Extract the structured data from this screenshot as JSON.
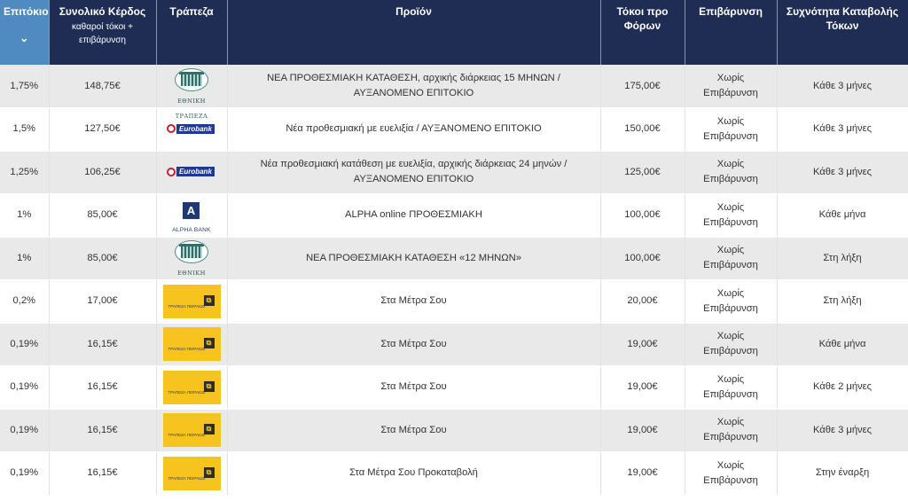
{
  "colors": {
    "header_bg": "#1f2d54",
    "header_sorted_bg": "#4f8bc0",
    "row_alt_bg": "#e9e9e9",
    "piraeus_yellow": "#f7c41f",
    "eurobank_blue": "#1c3a8f",
    "eurobank_red": "#c8202e",
    "alpha_blue": "#1f3a72",
    "nbg_teal": "#2e6f6a"
  },
  "header": {
    "rate": "Επιτόκιο",
    "sort_icon": "chevron-down-icon",
    "sort_glyph": "⌄",
    "gain": "Συνολικό Κέρδος",
    "gain_sub": "καθαροί τόκοι + επιβάρυνση",
    "bank": "Τράπεζα",
    "product": "Προϊόν",
    "interest": "Τόκοι προ Φόρων",
    "charge": "Επιβάρυνση",
    "frequency": "Συχνότητα Καταβολής Τόκων"
  },
  "logos": {
    "nbg": "ΕΘΝΙΚΗ ΤΡΑΠΕΖΑ",
    "eurobank": "Eurobank",
    "alpha": "ALPHA BANK",
    "alpha_glyph": "A",
    "piraeus": "ΤΡΑΠΕΖΑ ΠΕΙΡΑΙΩΣ",
    "piraeus_glyph": "⧉"
  },
  "rows": [
    {
      "rate": "1,75%",
      "gain": "148,75€",
      "bank": "nbg",
      "product": "ΝΕΑ ΠΡΟΘΕΣΜΙΑΚΗ ΚΑΤΑΘΕΣΗ, αρχικής διάρκειας 15 ΜΗΝΩΝ / ΑΥΞΑΝΟΜΕΝΟ ΕΠΙΤΟΚΙΟ",
      "interest": "175,00€",
      "charge": "Χωρίς Επιβάρυνση",
      "frequency": "Κάθε 3 μήνες"
    },
    {
      "rate": "1,5%",
      "gain": "127,50€",
      "bank": "eurobank",
      "product": "Νέα προθεσμιακή με ευελιξία / ΑΥΞΑΝΟΜΕΝΟ ΕΠΙΤΟΚΙΟ",
      "interest": "150,00€",
      "charge": "Χωρίς Επιβάρυνση",
      "frequency": "Κάθε 3 μήνες"
    },
    {
      "rate": "1,25%",
      "gain": "106,25€",
      "bank": "eurobank",
      "product": "Νέα προθεσμιακή κατάθεση με ευελιξία, αρχικής διάρκειας 24 μηνών / ΑΥΞΑΝΟΜΕΝΟ ΕΠΙΤΟΚΙΟ",
      "interest": "125,00€",
      "charge": "Χωρίς Επιβάρυνση",
      "frequency": "Κάθε 3 μήνες"
    },
    {
      "rate": "1%",
      "gain": "85,00€",
      "bank": "alpha",
      "product": "ALPHA online ΠΡΟΘΕΣΜΙΑΚΗ",
      "interest": "100,00€",
      "charge": "Χωρίς Επιβάρυνση",
      "frequency": "Κάθε μήνα"
    },
    {
      "rate": "1%",
      "gain": "85,00€",
      "bank": "nbg",
      "product": "ΝΕΑ ΠΡΟΘΕΣΜΙΑΚΗ ΚΑΤΑΘΕΣΗ «12 ΜΗΝΩΝ»",
      "interest": "100,00€",
      "charge": "Χωρίς Επιβάρυνση",
      "frequency": "Στη λήξη"
    },
    {
      "rate": "0,2%",
      "gain": "17,00€",
      "bank": "piraeus",
      "product": "Στα Μέτρα Σου",
      "interest": "20,00€",
      "charge": "Χωρίς Επιβάρυνση",
      "frequency": "Στη λήξη"
    },
    {
      "rate": "0,19%",
      "gain": "16,15€",
      "bank": "piraeus",
      "product": "Στα Μέτρα Σου",
      "interest": "19,00€",
      "charge": "Χωρίς Επιβάρυνση",
      "frequency": "Κάθε μήνα"
    },
    {
      "rate": "0,19%",
      "gain": "16,15€",
      "bank": "piraeus",
      "product": "Στα Μέτρα Σου",
      "interest": "19,00€",
      "charge": "Χωρίς Επιβάρυνση",
      "frequency": "Κάθε 2 μήνες"
    },
    {
      "rate": "0,19%",
      "gain": "16,15€",
      "bank": "piraeus",
      "product": "Στα Μέτρα Σου",
      "interest": "19,00€",
      "charge": "Χωρίς Επιβάρυνση",
      "frequency": "Κάθε 3 μήνες"
    },
    {
      "rate": "0,19%",
      "gain": "16,15€",
      "bank": "piraeus",
      "product": "Στα Μέτρα Σου Προκαταβολή",
      "interest": "19,00€",
      "charge": "Χωρίς Επιβάρυνση",
      "frequency": "Στην έναρξη"
    }
  ]
}
